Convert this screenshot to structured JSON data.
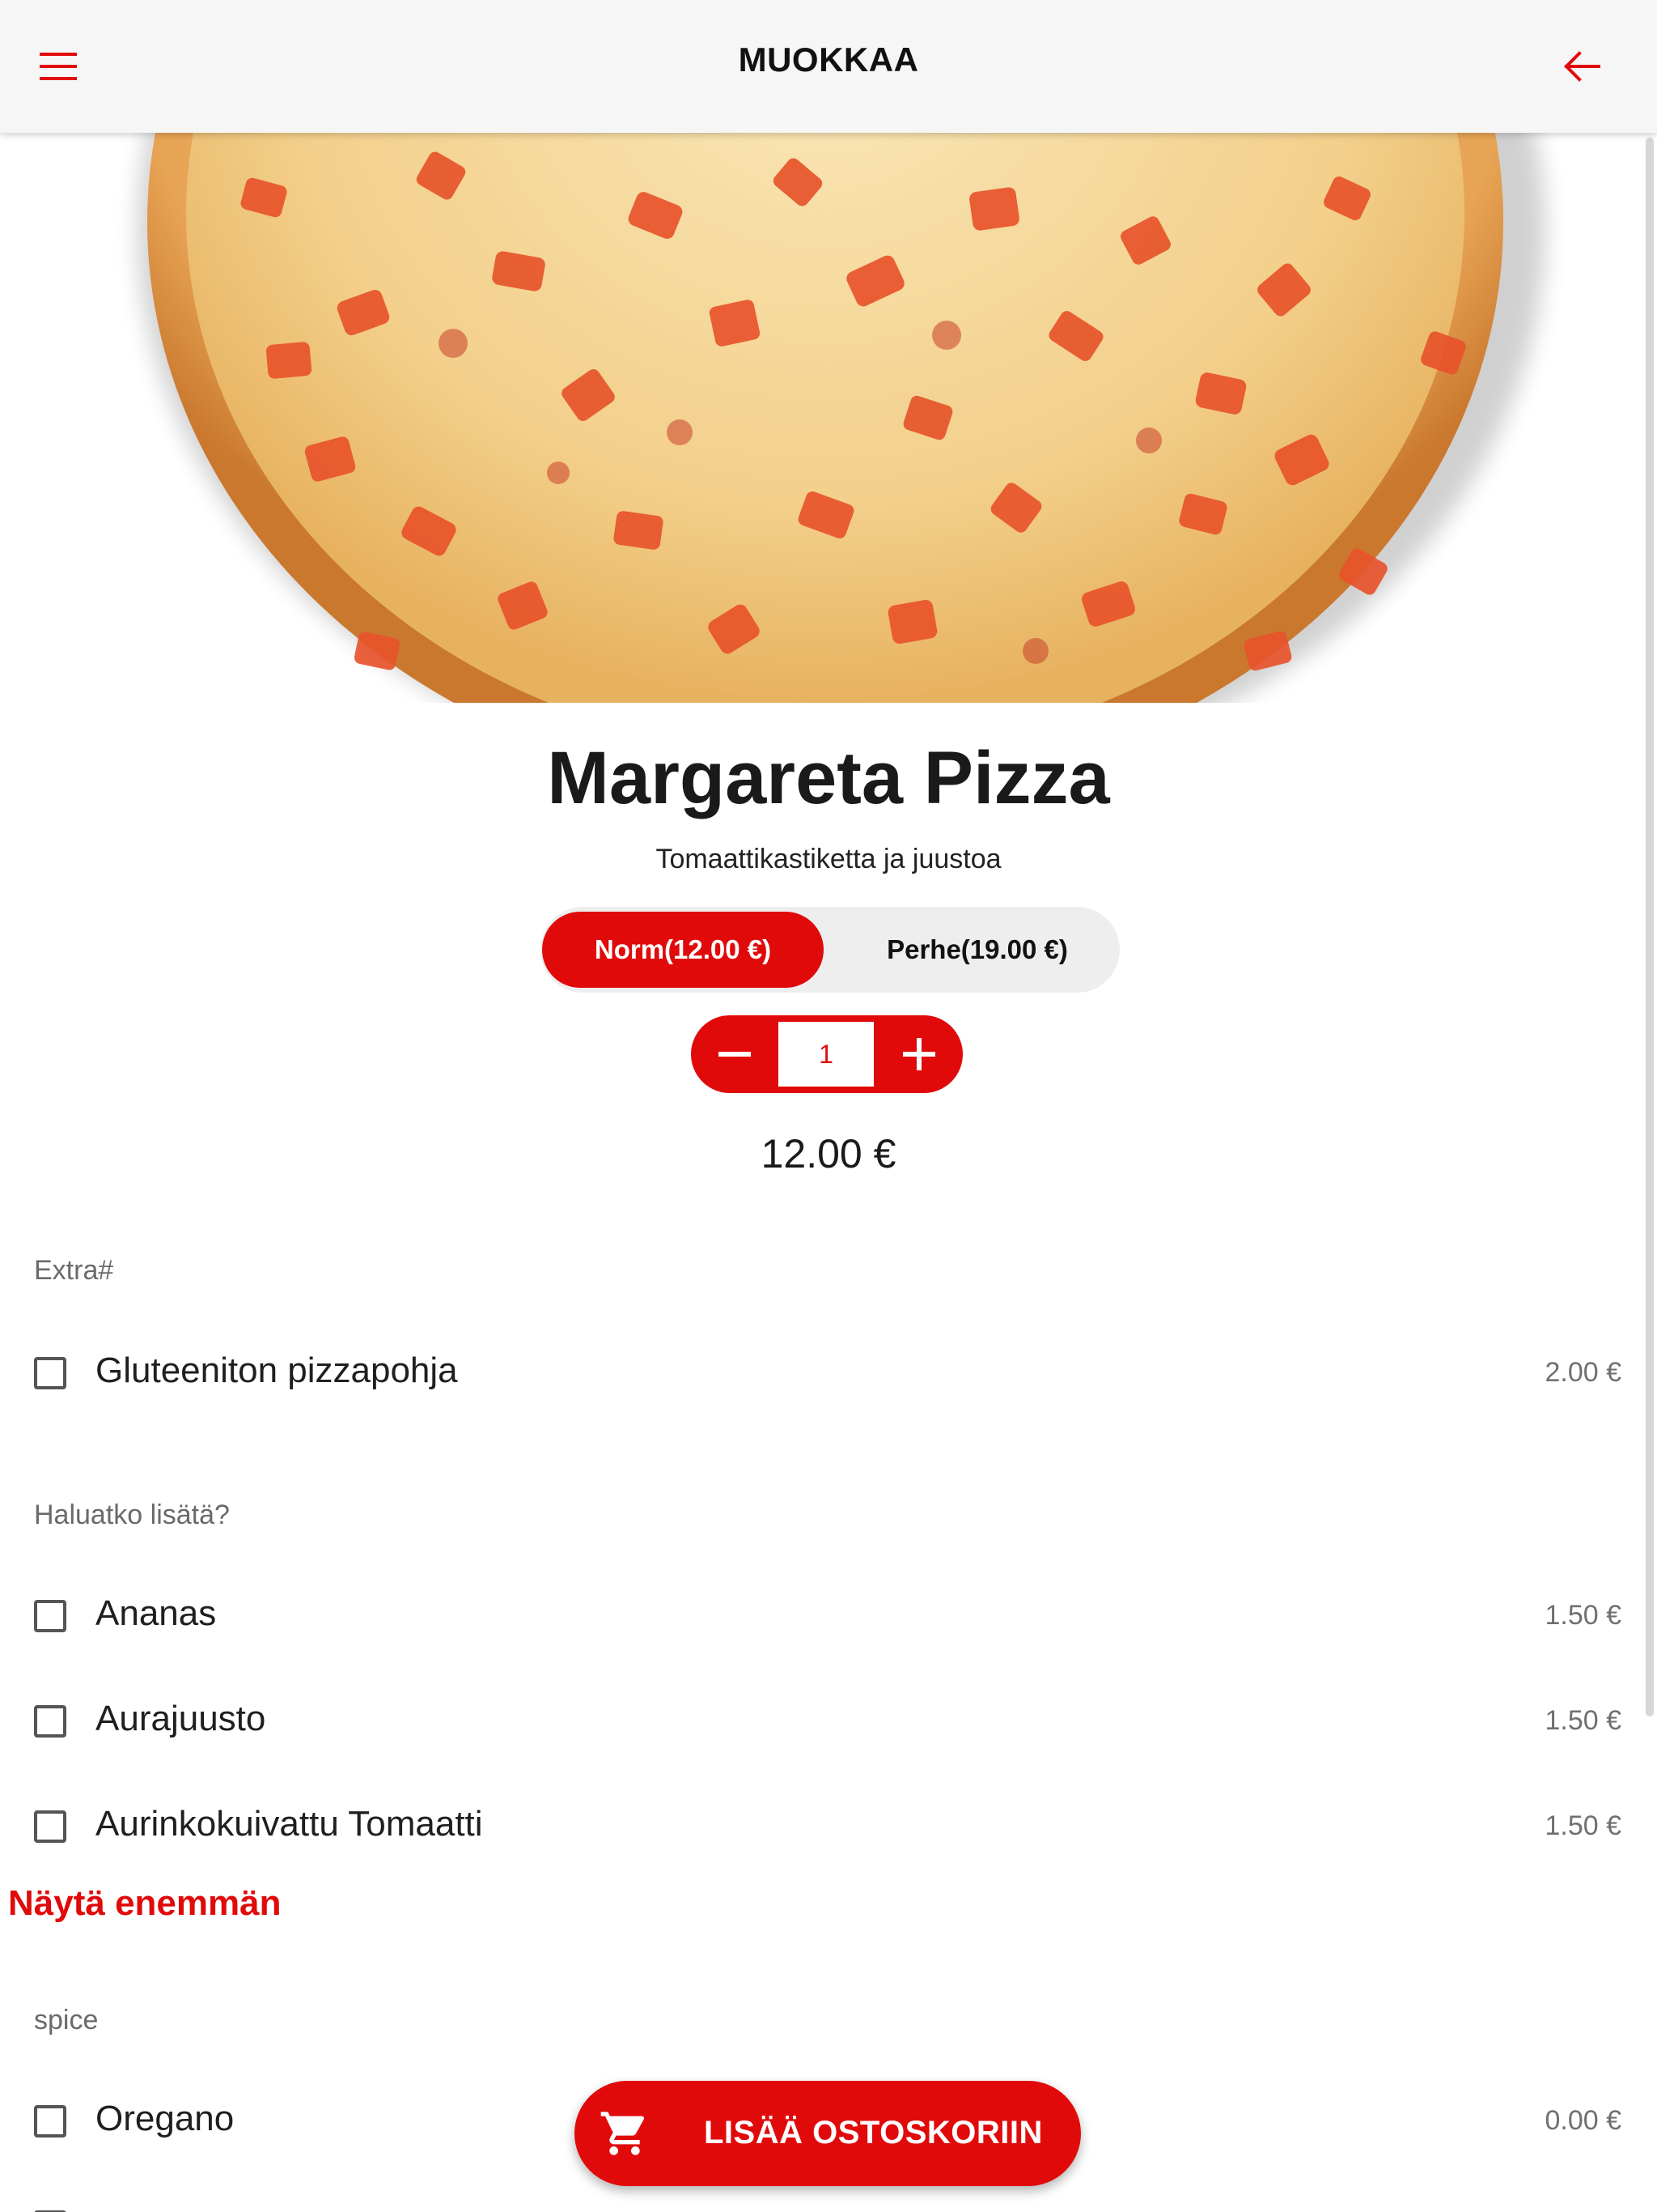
{
  "header": {
    "title": "MUOKKAA",
    "menu_icon": "hamburger-icon",
    "back_icon": "arrow-left-icon"
  },
  "colors": {
    "accent": "#e10a0a",
    "header_bg": "#f6f6f6",
    "muted_text": "#6a6a6a"
  },
  "product": {
    "name": "Margareta Pizza",
    "description": "Tomaattikastiketta ja juustoa",
    "sizes": [
      {
        "label": "Norm(12.00 €)",
        "selected": true
      },
      {
        "label": "Perhe(19.00 €)",
        "selected": false
      }
    ],
    "quantity": "1",
    "total_price": "12.00 €"
  },
  "groups": [
    {
      "label": "Extra#",
      "options": [
        {
          "name": "Gluteeniton pizzapohja",
          "price": "2.00 €"
        }
      ]
    },
    {
      "label": "Haluatko lisätä?",
      "options": [
        {
          "name": "Ananas",
          "price": "1.50 €"
        },
        {
          "name": "Aurajuusto",
          "price": "1.50 €"
        },
        {
          "name": "Aurinkokuivattu Tomaatti",
          "price": "1.50 €"
        }
      ],
      "show_more": "Näytä enemmän"
    },
    {
      "label": "spice",
      "options": [
        {
          "name": "Oregano",
          "price": "0.00 €"
        }
      ]
    }
  ],
  "cart_button": {
    "label": "LISÄÄ OSTOSKORIIN",
    "icon": "shopping-cart-icon"
  }
}
